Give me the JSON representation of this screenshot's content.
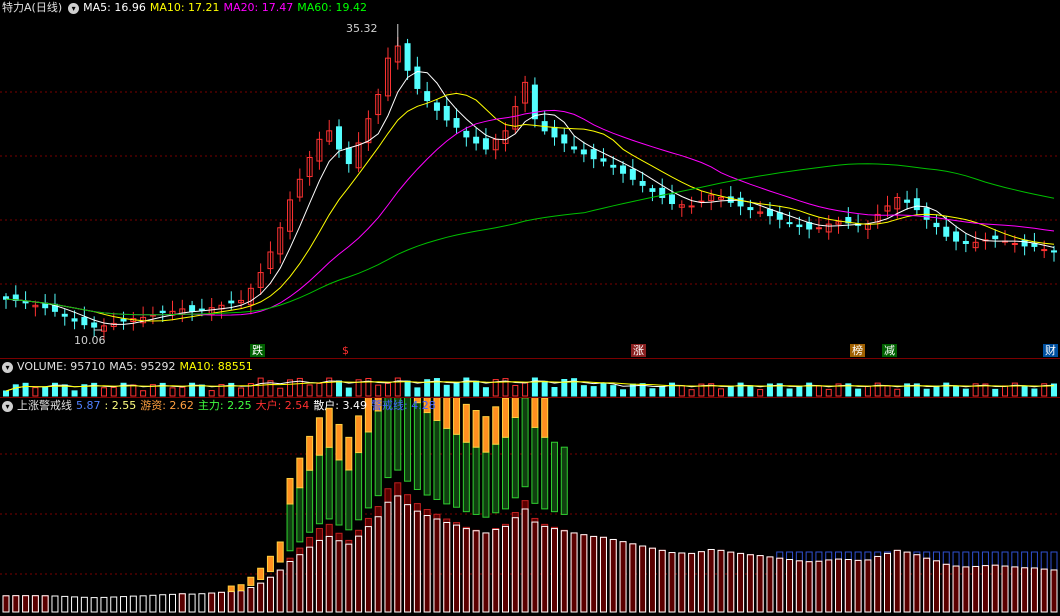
{
  "colors": {
    "background": "#000000",
    "up": "#ff3232",
    "down": "#54ffff",
    "ma5": "#ffffff",
    "ma10": "#ffff00",
    "ma20": "#ff00ff",
    "ma60": "#00c000",
    "grid": "#7a0000"
  },
  "price_panel": {
    "title": "特力A(日线)",
    "ma5_label": "MA5: 16.96",
    "ma10_label": "MA10: 17.21",
    "ma20_label": "MA20: 17.47",
    "ma60_label": "MA60: 19.42",
    "high_marker": "35.32",
    "low_marker": "10.06",
    "event_markers": [
      "跌",
      "$",
      "涨",
      "榜",
      "减",
      "财"
    ]
  },
  "volume_panel": {
    "label": "VOLUME: 95710",
    "ma5_label": "MA5: 95292",
    "ma10_label": "MA10: 88551"
  },
  "indicator_panel": {
    "name": "上涨警戒线",
    "value_1": "5.87",
    "value_2": ": 2.55",
    "youzi_label": "游资: 2.62",
    "zhuli_label": "主力: 2.25",
    "dahu_label": "大户: 2.54",
    "sanhu_label": "散户: 3.49",
    "jingjiexian_label": "警戒线: 4.28"
  },
  "chart_data": {
    "type": "candlestick",
    "price_range": [
      10.06,
      35.32
    ],
    "close": [
      12.6,
      12.5,
      12.3,
      12.1,
      11.9,
      11.6,
      11.2,
      10.8,
      10.5,
      10.3,
      10.4,
      10.6,
      10.8,
      11.0,
      11.1,
      11.3,
      11.5,
      11.6,
      11.8,
      11.6,
      11.7,
      11.9,
      12.1,
      12.3,
      12.5,
      13.5,
      14.8,
      16.5,
      18.5,
      20.8,
      22.5,
      24.3,
      25.8,
      26.5,
      25.0,
      23.8,
      25.5,
      27.5,
      29.5,
      32.5,
      33.5,
      31.5,
      30.0,
      29.0,
      28.2,
      27.4,
      26.8,
      26.0,
      25.5,
      25.0,
      25.8,
      26.5,
      28.5,
      30.5,
      27.5,
      26.5,
      26.0,
      25.5,
      25.0,
      24.6,
      24.2,
      24.0,
      23.5,
      23.0,
      22.5,
      22.0,
      21.5,
      21.0,
      20.5,
      20.4,
      20.3,
      20.7,
      21.2,
      21.0,
      20.6,
      20.3,
      20.0,
      19.8,
      19.5,
      19.2,
      18.9,
      18.6,
      18.4,
      18.5,
      18.8,
      19.0,
      18.9,
      18.7,
      18.8,
      19.6,
      20.3,
      21.0,
      20.6,
      20.0,
      19.2,
      18.6,
      17.8,
      17.4,
      17.2,
      17.3,
      17.5,
      17.6,
      17.4,
      17.2,
      17.0,
      16.96,
      16.7,
      16.5
    ]
  }
}
